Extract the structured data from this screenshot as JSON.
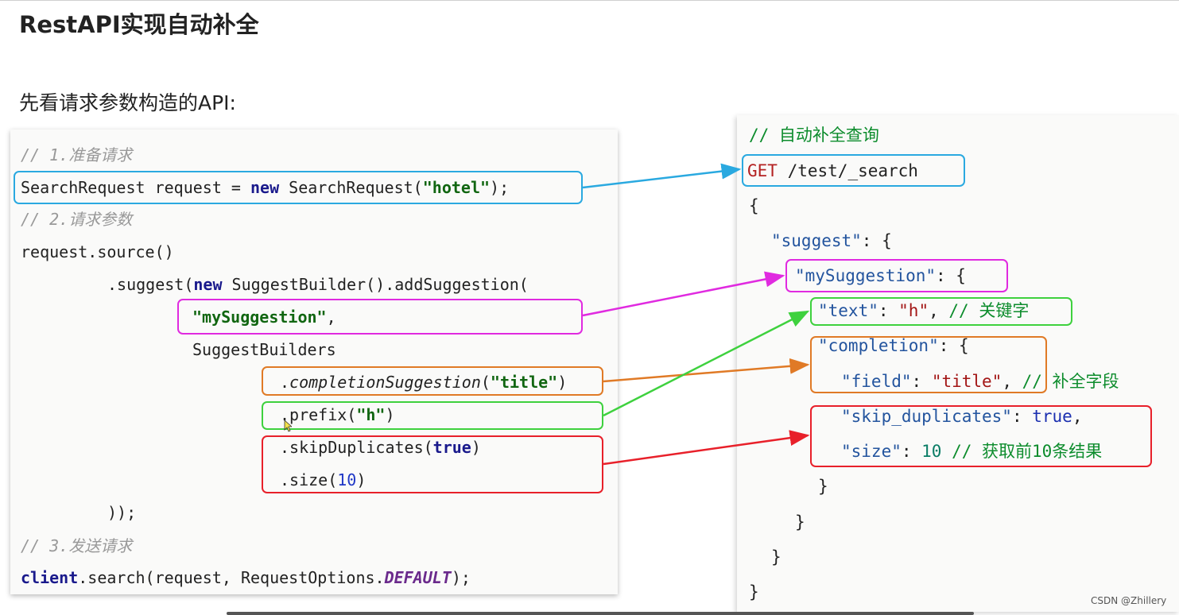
{
  "slide": {
    "title": "RestAPI实现自动补全",
    "subtitle": "先看请求参数构造的API:"
  },
  "java_code": {
    "c1": "// 1.准备请求",
    "l1_a": "SearchRequest request = ",
    "l1_kw": "new",
    "l1_b": " SearchRequest(",
    "l1_str": "\"hotel\"",
    "l1_c": ");",
    "c2": "// 2.请求参数",
    "l2": "request.source()",
    "l3_a": ".suggest(",
    "l3_kw": "new",
    "l3_b": " SuggestBuilder().addSuggestion(",
    "l4_str": "\"mySuggestion\"",
    "l4_b": ",",
    "l5": "SuggestBuilders",
    "l6_a": ".",
    "l6_it": "completionSuggestion",
    "l6_b": "(",
    "l6_str": "\"title\"",
    "l6_c": ")",
    "l7_a": ".prefix(",
    "l7_str": "\"h\"",
    "l7_c": ")",
    "l8_a": ".skipDuplicates(",
    "l8_kw": "true",
    "l8_c": ")",
    "l9_a": ".size(",
    "l9_num": "10",
    "l9_c": ")",
    "l10": "));",
    "c3": "// 3.发送请求",
    "l11_cls": "client",
    "l11_a": ".search(request, RequestOptions.",
    "l11_const": "DEFAULT",
    "l11_c": ");"
  },
  "dsl_code": {
    "comment": "// 自动补全查询",
    "get": "GET",
    "path": " /test/_search",
    "open": "{",
    "suggest_key": "\"suggest\"",
    "suggest_rest": ": {",
    "mysugg_key": "\"mySuggestion\"",
    "mysugg_rest": ": {",
    "text_key": "\"text\"",
    "text_colon": ": ",
    "text_val": "\"h\"",
    "text_comma": ", ",
    "text_cmt": "// 关键字",
    "compl_key": "\"completion\"",
    "compl_rest": ": {",
    "field_key": "\"field\"",
    "field_colon": ": ",
    "field_val": "\"title\"",
    "field_comma": ", ",
    "field_cmt": "// 补全字段",
    "skip_key": "\"skip_duplicates\"",
    "skip_colon": ": ",
    "skip_val": "true",
    "skip_comma": ",",
    "size_key": "\"size\"",
    "size_colon": ": ",
    "size_val": "10",
    "size_cmt": " // 获取前10条结果",
    "close1": "}",
    "close2": "}",
    "close3": "}",
    "close4": "}"
  },
  "colors": {
    "blue": "#2aa9e0",
    "magenta": "#e02ae0",
    "orange": "#e07a26",
    "green": "#3ed13e",
    "red": "#e8202a"
  },
  "watermark": "CSDN @Zhillery"
}
